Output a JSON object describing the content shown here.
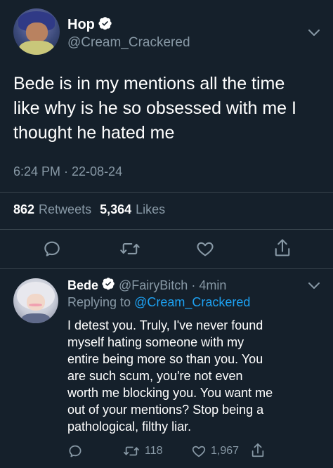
{
  "main_tweet": {
    "display_name": "Hop",
    "handle": "@Cream_Crackered",
    "text_lines": [
      "Bede is in my mentions all the time",
      "like why is he so obsessed with me I",
      "thought he hated me"
    ],
    "timestamp": "6:24 PM · 22-08-24",
    "retweets_count": "862",
    "retweets_label": "Retweets",
    "likes_count": "5,364",
    "likes_label": "Likes"
  },
  "reply": {
    "display_name": "Bede",
    "handle": "@FairyBitch",
    "separator": "·",
    "time": "4min",
    "replying_label": "Replying to",
    "replying_handle": "@Cream_Crackered",
    "text_lines": [
      "I detest you. Truly, I've never found",
      "myself hating someone with my",
      "entire being more so than you. You",
      "are such scum, you're not even",
      "worth me blocking you. You want me",
      "out of your mentions? Stop being a",
      "pathological, filthy liar."
    ],
    "retweets_count": "118",
    "likes_count": "1,967"
  },
  "colors": {
    "background": "#15202b",
    "text": "#ffffff",
    "muted": "#8899a6",
    "link": "#1da1f2",
    "divider": "#38444d"
  },
  "icons": {
    "verified": "verified-badge-icon",
    "menu": "chevron-down-icon",
    "reply": "comment-icon",
    "retweet": "retweet-icon",
    "like": "heart-icon",
    "share": "share-icon"
  }
}
